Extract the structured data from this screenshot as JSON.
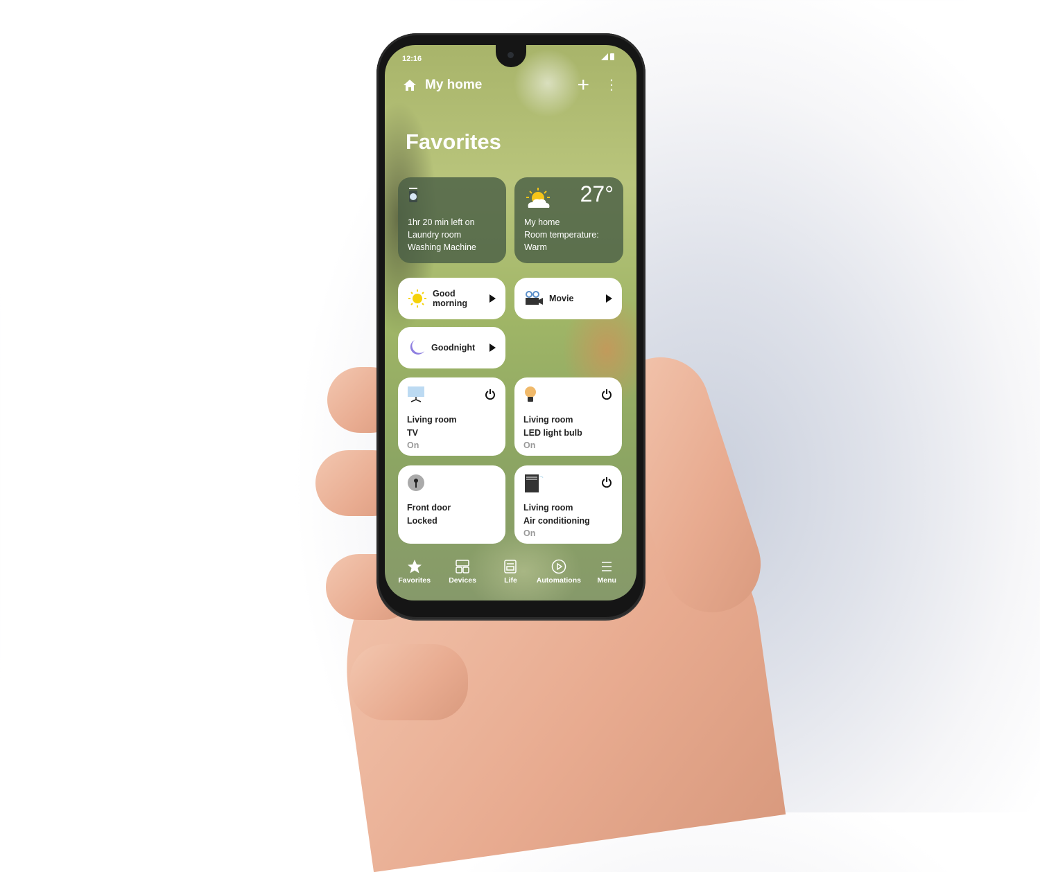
{
  "status_bar": {
    "time": "12:16",
    "icons": [
      "signal-icon",
      "battery-icon"
    ]
  },
  "header": {
    "title": "My home",
    "add_icon": "plus-icon",
    "more_icon": "kebab-menu-icon"
  },
  "section_title": "Favorites",
  "info_cards": [
    {
      "icon": "washing-machine-icon",
      "lines": [
        "1hr 20 min left on",
        "Laundry room",
        "Washing Machine"
      ]
    },
    {
      "icon": "partly-sunny-icon",
      "temperature": "27°",
      "lines": [
        "My home",
        "Room temperature:",
        "Warm"
      ]
    }
  ],
  "scenes": [
    {
      "icon": "sun-icon",
      "label": "Good morning",
      "action_icon": "play-icon"
    },
    {
      "icon": "video-camera-icon",
      "label": "Movie",
      "action_icon": "play-icon"
    },
    {
      "icon": "moon-icon",
      "label": "Goodnight",
      "action_icon": "play-icon"
    }
  ],
  "devices": [
    {
      "icon": "tv-icon",
      "room": "Living room",
      "name": "TV",
      "state": "On",
      "power_icon": true
    },
    {
      "icon": "light-bulb-icon",
      "room": "Living room",
      "name": "LED light bulb",
      "state": "On",
      "power_icon": true
    },
    {
      "icon": "door-lock-icon",
      "room": "Front door",
      "name": "Locked",
      "state": "",
      "power_icon": false
    },
    {
      "icon": "air-conditioner-icon",
      "room": "Living room",
      "name": "Air conditioning",
      "state": "On",
      "power_icon": true
    }
  ],
  "bottom_nav": [
    {
      "label": "Favorites",
      "icon": "star-icon",
      "active": true
    },
    {
      "label": "Devices",
      "icon": "devices-grid-icon",
      "active": false
    },
    {
      "label": "Life",
      "icon": "life-icon",
      "active": false
    },
    {
      "label": "Automations",
      "icon": "play-circle-icon",
      "active": false
    },
    {
      "label": "Menu",
      "icon": "hamburger-menu-icon",
      "active": false
    }
  ]
}
